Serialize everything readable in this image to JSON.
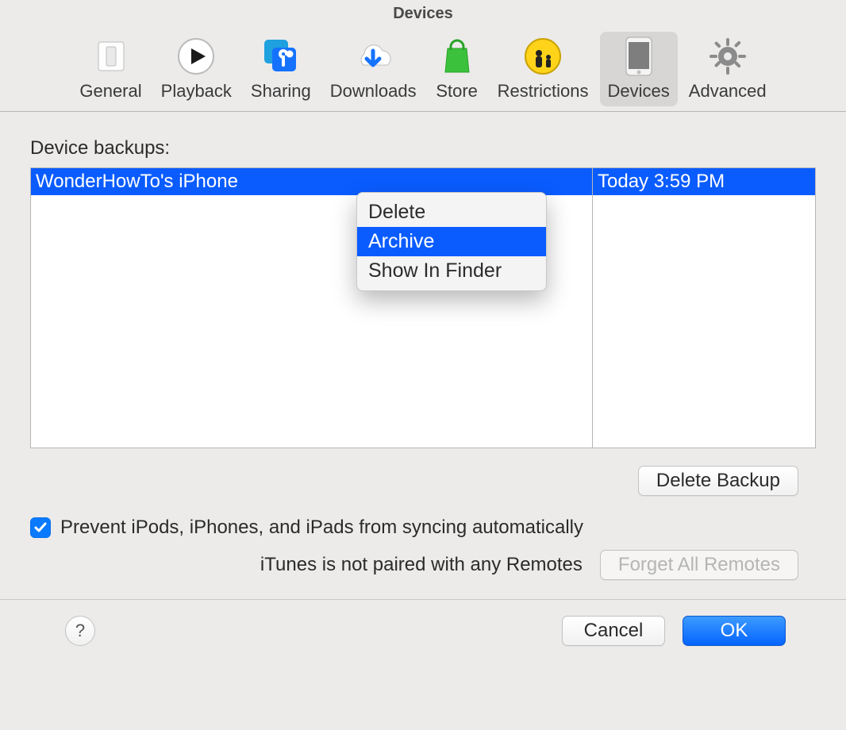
{
  "window": {
    "title": "Devices"
  },
  "toolbar": {
    "items": [
      {
        "label": "General"
      },
      {
        "label": "Playback"
      },
      {
        "label": "Sharing"
      },
      {
        "label": "Downloads"
      },
      {
        "label": "Store"
      },
      {
        "label": "Restrictions"
      },
      {
        "label": "Devices"
      },
      {
        "label": "Advanced"
      }
    ],
    "selected": "Devices"
  },
  "backups": {
    "section_label": "Device backups:",
    "rows": [
      {
        "name": "WonderHowTo's iPhone",
        "date": "Today 3:59 PM"
      }
    ]
  },
  "context_menu": {
    "items": [
      "Delete",
      "Archive",
      "Show In Finder"
    ],
    "highlighted": "Archive"
  },
  "buttons": {
    "delete_backup": "Delete Backup",
    "forget_all_remotes": "Forget All Remotes",
    "cancel": "Cancel",
    "ok": "OK",
    "help": "?"
  },
  "options": {
    "prevent_sync_checked": true,
    "prevent_sync_label": "Prevent iPods, iPhones, and iPads from syncing automatically",
    "remotes_status": "iTunes is not paired with any Remotes"
  }
}
